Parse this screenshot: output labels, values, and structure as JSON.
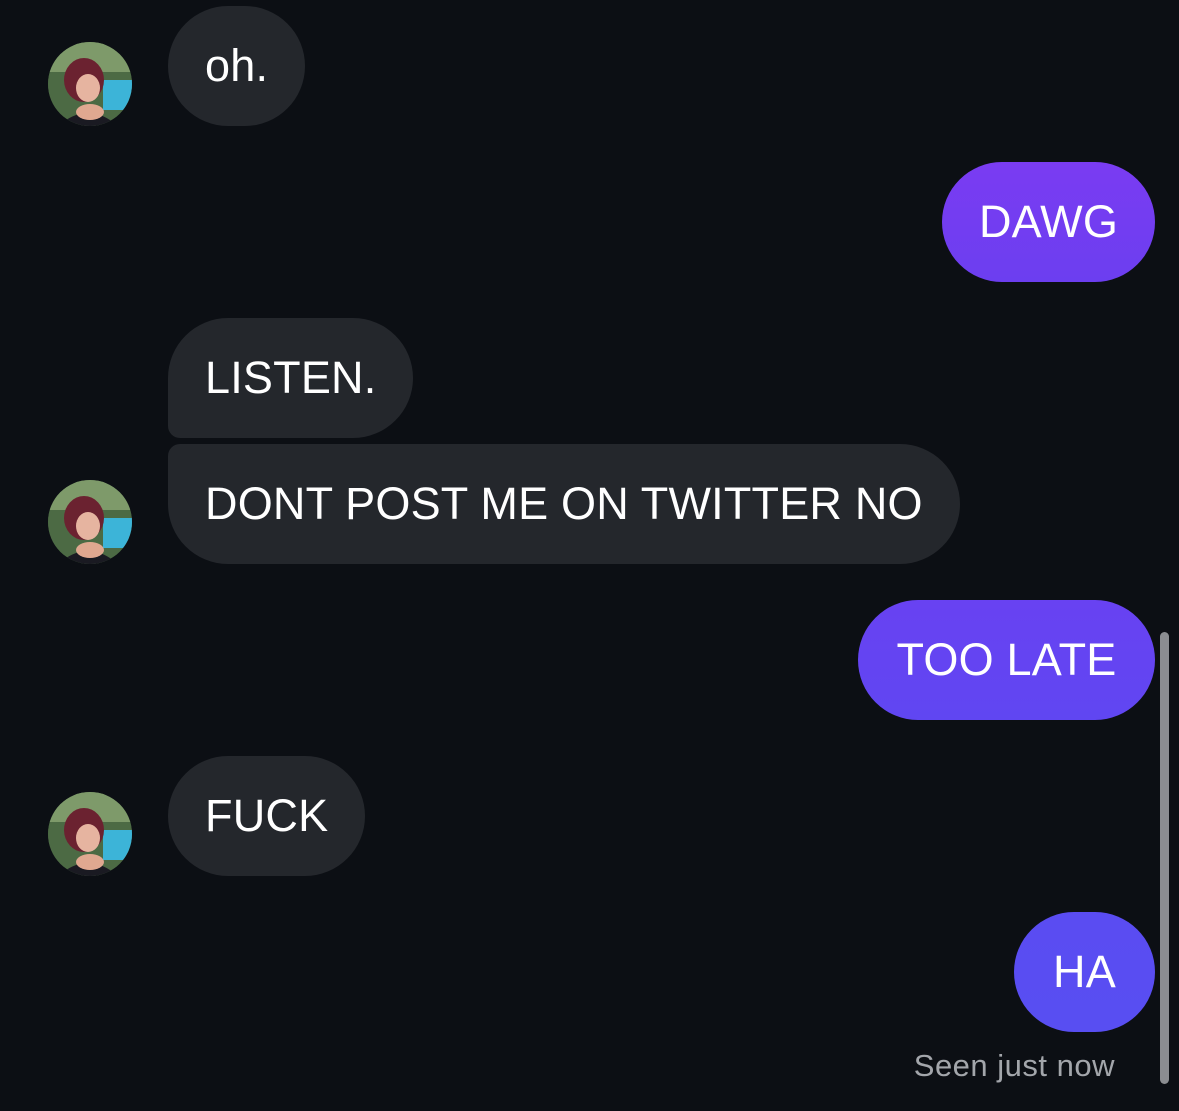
{
  "messages": [
    {
      "from": "other",
      "text": "oh."
    },
    {
      "from": "me",
      "text": "DAWG"
    },
    {
      "from": "other",
      "text": "LISTEN."
    },
    {
      "from": "other",
      "text": "DONT POST ME ON TWITTER NO"
    },
    {
      "from": "me",
      "text": "TOO LATE"
    },
    {
      "from": "other",
      "text": "FUCK"
    },
    {
      "from": "me",
      "text": "HA"
    }
  ],
  "status": {
    "seen": "Seen just now"
  },
  "colors": {
    "background": "#0c0f14",
    "incoming_bubble": "#24272c",
    "outgoing_gradient_top": "#7a3cf0",
    "outgoing_gradient_bottom": "#5a4cf2"
  },
  "icons": {
    "avatar": "contact-avatar-photo"
  }
}
